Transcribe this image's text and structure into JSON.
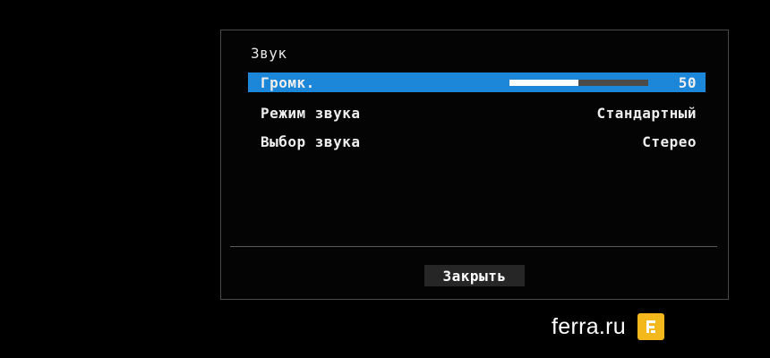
{
  "panel": {
    "title": "Звук"
  },
  "menu": {
    "volume": {
      "label": "Громк.",
      "value": "50",
      "level_fraction": 0.5
    },
    "sound_mode": {
      "label": "Режим звука",
      "value": "Стандартный"
    },
    "sound_select": {
      "label": "Выбор звука",
      "value": "Стерео"
    }
  },
  "close_button": {
    "label": "Закрыть"
  },
  "watermark": {
    "text": "ferra.ru",
    "logo_icon": "ferra-logo-icon"
  },
  "colors": {
    "selection": "#1c86d8",
    "logo": "#f2b81c",
    "background": "#000000"
  }
}
